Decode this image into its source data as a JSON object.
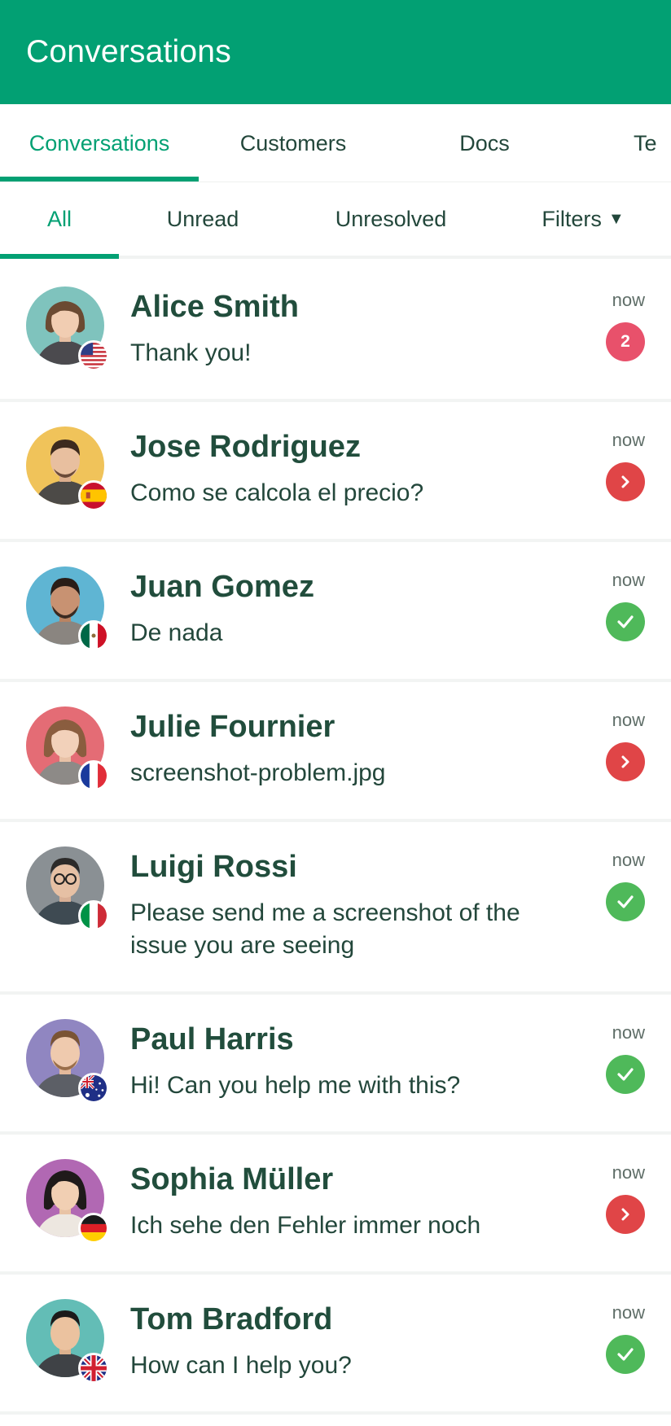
{
  "app_bar": {
    "title": "Conversations"
  },
  "tabs": [
    {
      "label": "Conversations",
      "active": true
    },
    {
      "label": "Customers",
      "active": false
    },
    {
      "label": "Docs",
      "active": false
    },
    {
      "label": "Te",
      "active": false
    }
  ],
  "subtabs": [
    {
      "label": "All",
      "active": true
    },
    {
      "label": "Unread",
      "active": false
    },
    {
      "label": "Unresolved",
      "active": false
    },
    {
      "label": "Filters",
      "active": false,
      "icon": "caret-down-icon"
    }
  ],
  "conversations": [
    {
      "name": "Alice Smith",
      "message": "Thank you!",
      "time": "now",
      "status": "unread-count",
      "unread_count": "2",
      "flag": "us",
      "avatar_bg": "#7fc3bd"
    },
    {
      "name": "Jose Rodriguez",
      "message": "Como se calcola el precio?",
      "time": "now",
      "status": "pending",
      "flag": "es",
      "avatar_bg": "#f0c35a"
    },
    {
      "name": "Juan Gomez",
      "message": "De nada",
      "time": "now",
      "status": "resolved",
      "flag": "mx",
      "avatar_bg": "#5fb5d3"
    },
    {
      "name": "Julie Fournier",
      "message": "screenshot-problem.jpg",
      "time": "now",
      "status": "pending",
      "flag": "fr",
      "avatar_bg": "#e46c75"
    },
    {
      "name": "Luigi Rossi",
      "message": "Please send me a screenshot of the issue you are seeing",
      "time": "now",
      "status": "resolved",
      "flag": "it",
      "avatar_bg": "#8a9094"
    },
    {
      "name": "Paul Harris",
      "message": "Hi! Can you help me with this?",
      "time": "now",
      "status": "resolved",
      "flag": "au",
      "avatar_bg": "#9086c1"
    },
    {
      "name": "Sophia Müller",
      "message": "Ich sehe den Fehler immer noch",
      "time": "now",
      "status": "pending",
      "flag": "de",
      "avatar_bg": "#b168b3"
    },
    {
      "name": "Tom Bradford",
      "message": "How can I help you?",
      "time": "now",
      "status": "resolved",
      "flag": "gb",
      "avatar_bg": "#63bdb6"
    }
  ],
  "colors": {
    "brand": "#02a073",
    "unread_badge": "#e8516b",
    "pending": "#e04547",
    "resolved": "#4fb95a"
  }
}
